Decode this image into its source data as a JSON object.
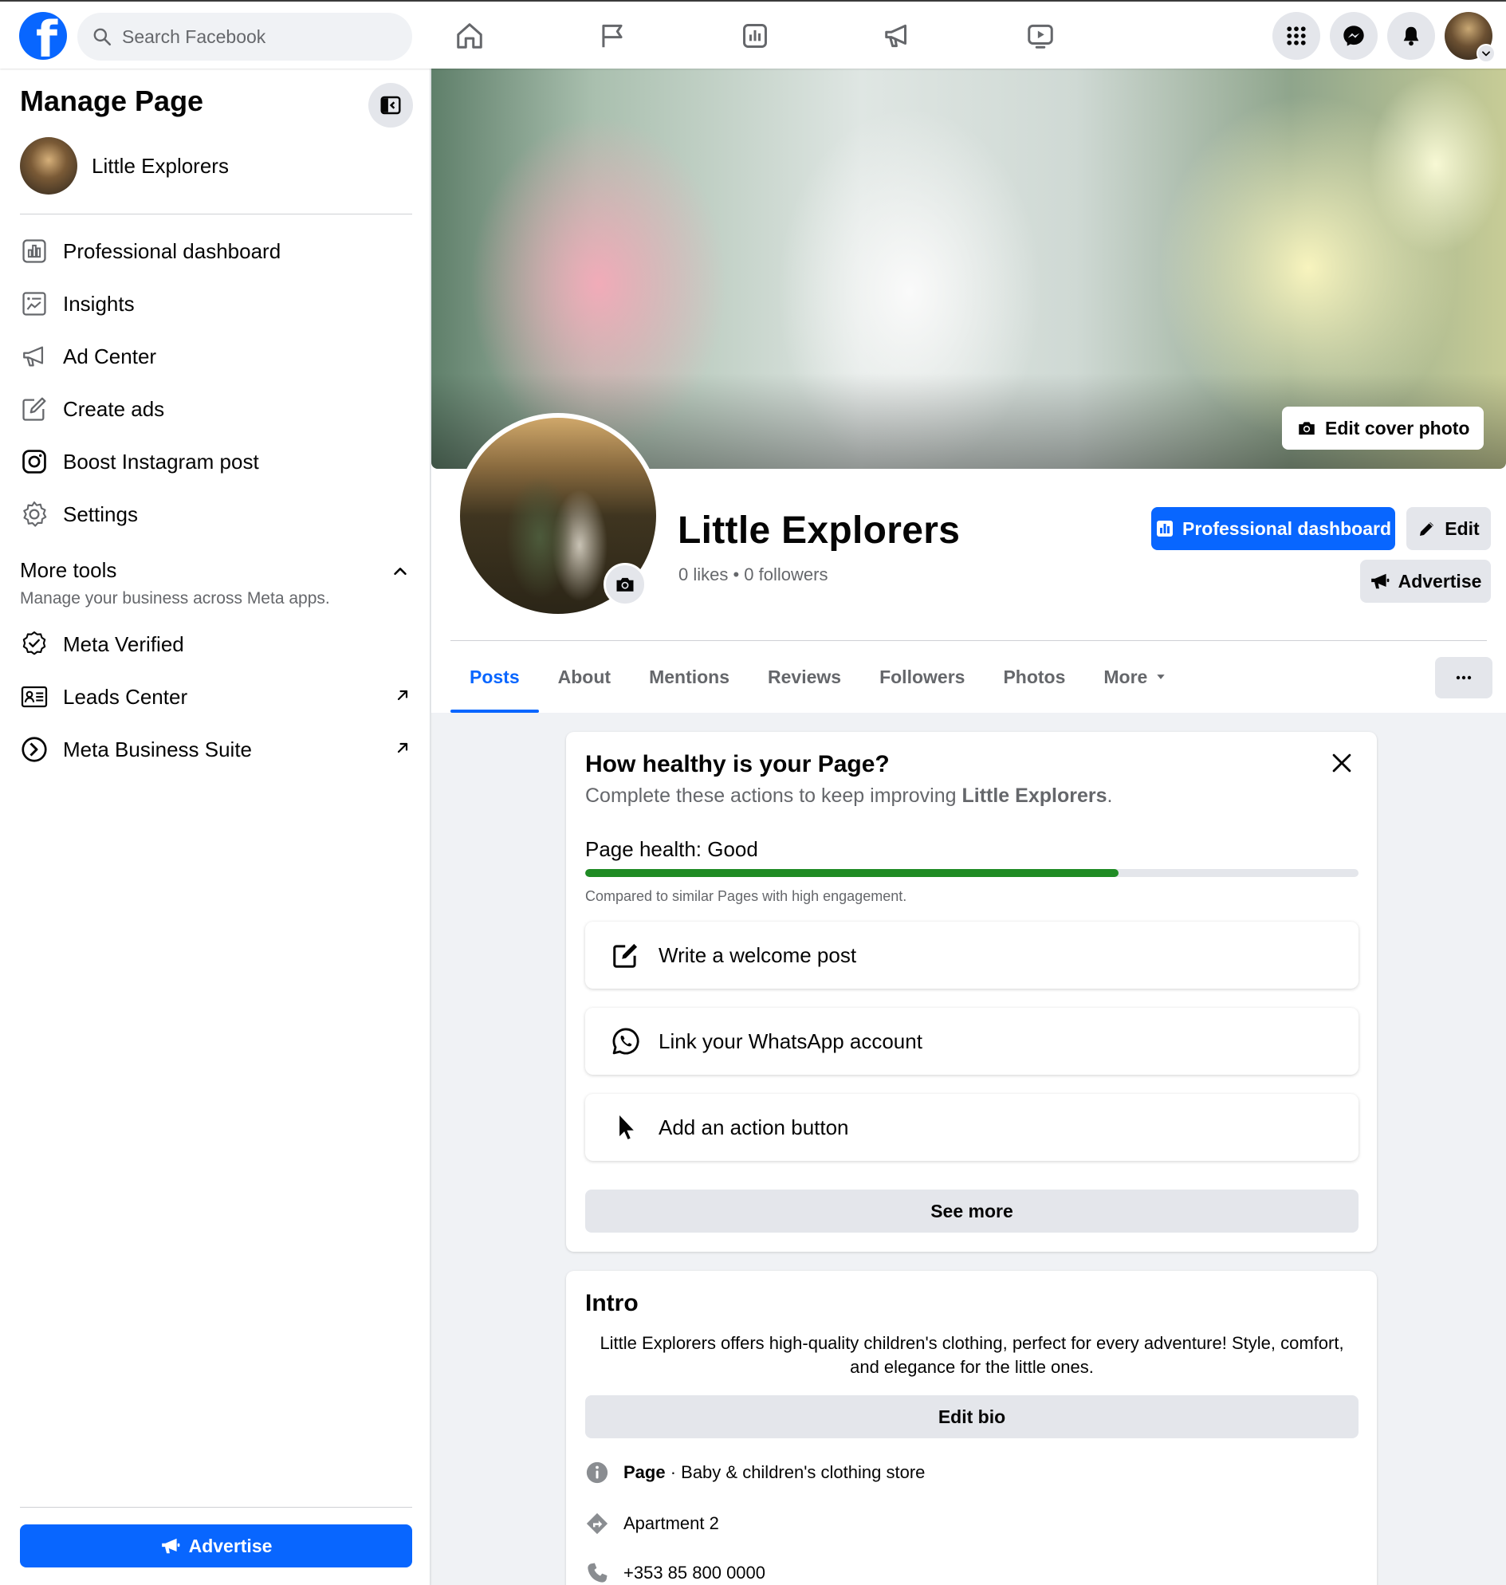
{
  "colors": {
    "brand": "#0866ff",
    "health_bar": "#1f8b24",
    "muted_text": "#65676b",
    "button_grey": "#e4e6eb"
  },
  "topbar": {
    "logo": "facebook-logo",
    "search_placeholder": "Search Facebook",
    "nav_icons": [
      "home-icon",
      "flag-icon",
      "insights-icon",
      "megaphone-icon",
      "video-icon"
    ],
    "right_icons": [
      "menu-grid-icon",
      "messenger-icon",
      "bell-icon",
      "account-avatar"
    ]
  },
  "sidebar": {
    "title": "Manage Page",
    "page_name": "Little Explorers",
    "items": [
      {
        "label": "Professional dashboard",
        "icon": "dashboard-icon"
      },
      {
        "label": "Insights",
        "icon": "insights-icon"
      },
      {
        "label": "Ad Center",
        "icon": "megaphone-icon"
      },
      {
        "label": "Create ads",
        "icon": "edit-icon"
      },
      {
        "label": "Boost Instagram post",
        "icon": "instagram-icon"
      },
      {
        "label": "Settings",
        "icon": "gear-icon"
      }
    ],
    "more_tools": {
      "title": "More tools",
      "subtitle": "Manage your business across Meta apps."
    },
    "tools": [
      {
        "label": "Meta Verified",
        "icon": "verified-badge-icon",
        "external": false
      },
      {
        "label": "Leads Center",
        "icon": "contact-card-icon",
        "external": true
      },
      {
        "label": "Meta Business Suite",
        "icon": "business-suite-icon",
        "external": true
      }
    ],
    "advertise_label": "Advertise"
  },
  "header": {
    "edit_cover_label": "Edit cover photo",
    "page_name": "Little Explorers",
    "stats": "0 likes • 0 followers",
    "professional_dashboard_label": "Professional dashboard",
    "edit_label": "Edit",
    "advertise_label": "Advertise"
  },
  "tabs": [
    {
      "label": "Posts",
      "active": true
    },
    {
      "label": "About",
      "active": false
    },
    {
      "label": "Mentions",
      "active": false
    },
    {
      "label": "Reviews",
      "active": false
    },
    {
      "label": "Followers",
      "active": false
    },
    {
      "label": "Photos",
      "active": false
    },
    {
      "label": "More",
      "active": false
    }
  ],
  "health": {
    "title": "How healthy is your Page?",
    "subtitle_prefix": "Complete these actions to keep improving ",
    "subtitle_page": "Little Explorers",
    "subtitle_suffix": ".",
    "status": "Page health: Good",
    "progress": 0.69,
    "note": "Compared to similar Pages with high engagement.",
    "actions": [
      {
        "label": "Write a welcome post",
        "icon": "compose-icon"
      },
      {
        "label": "Link your WhatsApp account",
        "icon": "whatsapp-icon"
      },
      {
        "label": "Add an action button",
        "icon": "cursor-icon"
      }
    ],
    "see_more_label": "See more"
  },
  "intro": {
    "title": "Intro",
    "bio": "Little Explorers offers high-quality children's clothing, perfect for every adventure! Style, comfort, and elegance for the little ones.",
    "edit_bio_label": "Edit bio",
    "category_bold": "Page",
    "category_text": " · Baby & children's clothing store",
    "address": "Apartment 2",
    "phone": "+353 85 800 0000"
  }
}
